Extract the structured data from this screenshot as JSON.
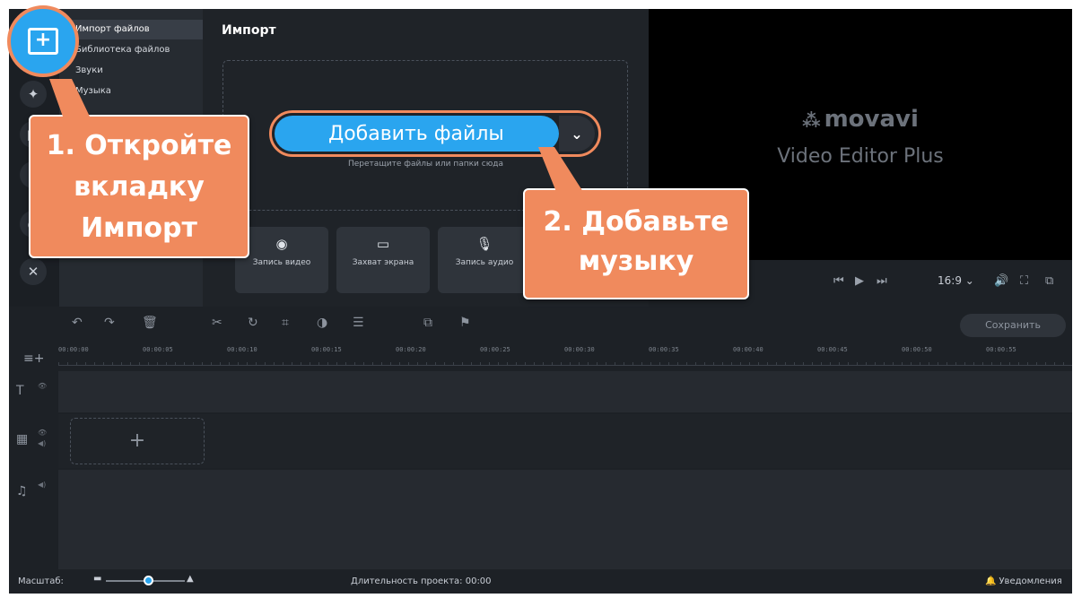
{
  "import_menu": {
    "items": [
      "Импорт файлов",
      "Библиотека файлов",
      "Звуки",
      "Музыка"
    ],
    "active_index": 0
  },
  "import_panel": {
    "title": "Импорт",
    "add_files_label": "Добавить файлы",
    "drop_hint": "Перетащите файлы или папки сюда",
    "capture_buttons": [
      {
        "icon": "webcam-icon",
        "label": "Запись видео"
      },
      {
        "icon": "monitor-icon",
        "label": "Захват экрана"
      },
      {
        "icon": "microphone-icon",
        "label": "Запись аудио"
      }
    ]
  },
  "preview": {
    "logo": "movavi",
    "subtitle": "Video Editor Plus",
    "aspect_ratio": "16:9"
  },
  "timeline": {
    "save_label": "Сохранить",
    "ruler_ticks": [
      "00:00:00",
      "00:00:05",
      "00:00:10",
      "00:00:15",
      "00:00:20",
      "00:00:25",
      "00:00:30",
      "00:00:35",
      "00:00:40",
      "00:00:45",
      "00:00:50",
      "00:00:55"
    ]
  },
  "status_bar": {
    "zoom_label": "Масштаб:",
    "duration": "Длительность проекта: 00:00",
    "notifications": "Уведомления"
  },
  "callouts": {
    "step1": "1. Откройте вкладку Импорт",
    "step2": "2. Добавьте музыку"
  },
  "colors": {
    "accent": "#2aa5ef",
    "callout": "#f08a5d",
    "background": "#1d2126"
  }
}
